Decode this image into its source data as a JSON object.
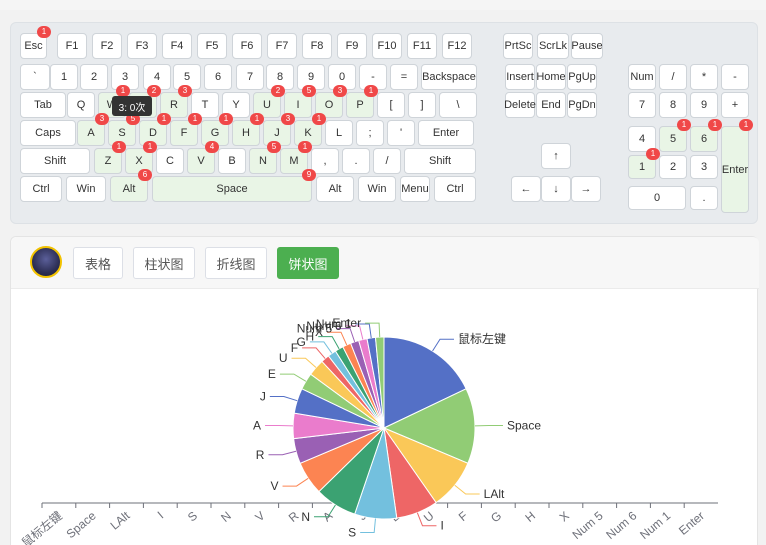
{
  "keyboard": {
    "rows": [
      [
        {
          "id": "esc",
          "label": "Esc",
          "count": "1"
        },
        {
          "id": "f1",
          "label": "F1"
        },
        {
          "id": "f2",
          "label": "F2"
        },
        {
          "id": "f3",
          "label": "F3"
        },
        {
          "id": "f4",
          "label": "F4"
        },
        {
          "id": "f5",
          "label": "F5"
        },
        {
          "id": "f6",
          "label": "F6"
        },
        {
          "id": "f7",
          "label": "F7"
        },
        {
          "id": "f8",
          "label": "F8"
        },
        {
          "id": "f9",
          "label": "F9"
        },
        {
          "id": "f10",
          "label": "F10"
        },
        {
          "id": "f11",
          "label": "F11"
        },
        {
          "id": "f12",
          "label": "F12"
        },
        {
          "id": "prtsc",
          "label": "PrtSc"
        },
        {
          "id": "scrlk",
          "label": "ScrLk"
        },
        {
          "id": "pause",
          "label": "Pause"
        }
      ],
      [
        {
          "id": "backtick",
          "label": "`"
        },
        {
          "id": "d1",
          "label": "1"
        },
        {
          "id": "d2",
          "label": "2"
        },
        {
          "id": "d3",
          "label": "3"
        },
        {
          "id": "d4",
          "label": "4"
        },
        {
          "id": "d5",
          "label": "5"
        },
        {
          "id": "d6",
          "label": "6"
        },
        {
          "id": "d7",
          "label": "7"
        },
        {
          "id": "d8",
          "label": "8"
        },
        {
          "id": "d9",
          "label": "9"
        },
        {
          "id": "d0",
          "label": "0"
        },
        {
          "id": "minus",
          "label": "-"
        },
        {
          "id": "equal",
          "label": "="
        },
        {
          "id": "backspace",
          "label": "Backspace"
        },
        {
          "id": "insert",
          "label": "Insert"
        },
        {
          "id": "home",
          "label": "Home"
        },
        {
          "id": "pgup",
          "label": "PgUp"
        },
        {
          "id": "numlock",
          "label": "Num"
        },
        {
          "id": "numdiv",
          "label": "/"
        },
        {
          "id": "nummul",
          "label": "*"
        },
        {
          "id": "numsub",
          "label": "-"
        }
      ],
      [
        {
          "id": "tab",
          "label": "Tab"
        },
        {
          "id": "q",
          "label": "Q"
        },
        {
          "id": "w",
          "label": "W",
          "count": "1",
          "pressed": true
        },
        {
          "id": "e",
          "label": "E",
          "count": "2",
          "pressed": true
        },
        {
          "id": "r",
          "label": "R",
          "count": "3",
          "pressed": true
        },
        {
          "id": "t",
          "label": "T"
        },
        {
          "id": "y",
          "label": "Y"
        },
        {
          "id": "u",
          "label": "U",
          "count": "2",
          "pressed": true
        },
        {
          "id": "i",
          "label": "I",
          "count": "5",
          "pressed": true
        },
        {
          "id": "o",
          "label": "O",
          "count": "3",
          "pressed": true
        },
        {
          "id": "p",
          "label": "P",
          "count": "1",
          "pressed": true
        },
        {
          "id": "lbracket",
          "label": "["
        },
        {
          "id": "rbracket",
          "label": "]"
        },
        {
          "id": "backslash",
          "label": "\\"
        },
        {
          "id": "delete",
          "label": "Delete"
        },
        {
          "id": "end",
          "label": "End"
        },
        {
          "id": "pgdn",
          "label": "PgDn"
        },
        {
          "id": "num7",
          "label": "7"
        },
        {
          "id": "num8",
          "label": "8"
        },
        {
          "id": "num9",
          "label": "9"
        },
        {
          "id": "numadd",
          "label": "+"
        }
      ],
      [
        {
          "id": "caps",
          "label": "Caps"
        },
        {
          "id": "a",
          "label": "A",
          "count": "3",
          "pressed": true
        },
        {
          "id": "s",
          "label": "S",
          "count": "5",
          "pressed": true
        },
        {
          "id": "d",
          "label": "D",
          "count": "1",
          "pressed": true
        },
        {
          "id": "f",
          "label": "F",
          "count": "1",
          "pressed": true
        },
        {
          "id": "g",
          "label": "G",
          "count": "1",
          "pressed": true
        },
        {
          "id": "h",
          "label": "H",
          "count": "1",
          "pressed": true
        },
        {
          "id": "j",
          "label": "J",
          "count": "3",
          "pressed": true
        },
        {
          "id": "k",
          "label": "K",
          "count": "1",
          "pressed": true
        },
        {
          "id": "l",
          "label": "L"
        },
        {
          "id": "semicolon",
          "label": ";"
        },
        {
          "id": "quote",
          "label": "'"
        },
        {
          "id": "enter",
          "label": "Enter"
        },
        {
          "id": "num4",
          "label": "4"
        },
        {
          "id": "num5",
          "label": "5",
          "count": "1",
          "pressed": true
        },
        {
          "id": "num6",
          "label": "6",
          "count": "1",
          "pressed": true
        },
        {
          "id": "numenter",
          "label": "Enter",
          "count": "1",
          "pressed": true
        }
      ],
      [
        {
          "id": "lshift",
          "label": "Shift"
        },
        {
          "id": "z",
          "label": "Z",
          "count": "1",
          "pressed": true
        },
        {
          "id": "x",
          "label": "X",
          "count": "1",
          "pressed": true
        },
        {
          "id": "c",
          "label": "C"
        },
        {
          "id": "v",
          "label": "V",
          "count": "4",
          "pressed": true
        },
        {
          "id": "b",
          "label": "B"
        },
        {
          "id": "n",
          "label": "N",
          "count": "5",
          "pressed": true
        },
        {
          "id": "m",
          "label": "M",
          "count": "1",
          "pressed": true
        },
        {
          "id": "comma",
          "label": ","
        },
        {
          "id": "period",
          "label": "."
        },
        {
          "id": "slash",
          "label": "/"
        },
        {
          "id": "rshift",
          "label": "Shift"
        },
        {
          "id": "up",
          "label": "↑"
        },
        {
          "id": "num1",
          "label": "1",
          "count": "1",
          "pressed": true
        },
        {
          "id": "num2",
          "label": "2"
        },
        {
          "id": "num3",
          "label": "3"
        }
      ],
      [
        {
          "id": "lctrl",
          "label": "Ctrl"
        },
        {
          "id": "lwin",
          "label": "Win"
        },
        {
          "id": "lalt",
          "label": "Alt",
          "count": "6",
          "pressed": true
        },
        {
          "id": "space",
          "label": "Space",
          "count": "9",
          "pressed": true
        },
        {
          "id": "ralt",
          "label": "Alt"
        },
        {
          "id": "rwin",
          "label": "Win"
        },
        {
          "id": "menu",
          "label": "Menu"
        },
        {
          "id": "rctrl",
          "label": "Ctrl"
        },
        {
          "id": "left",
          "label": "←"
        },
        {
          "id": "down",
          "label": "↓"
        },
        {
          "id": "right",
          "label": "→"
        },
        {
          "id": "num0",
          "label": "0"
        },
        {
          "id": "numdot",
          "label": "."
        }
      ]
    ],
    "tooltip": "3: 0次"
  },
  "tabs": [
    {
      "id": "table",
      "label": "表格"
    },
    {
      "id": "bar",
      "label": "柱状图"
    },
    {
      "id": "line",
      "label": "折线图"
    },
    {
      "id": "pie",
      "label": "饼状图",
      "active": true
    }
  ],
  "colors": {
    "accent": "#4caf50",
    "badge": "#f04848",
    "pressed": "#e9f5e6"
  },
  "chart_data": {
    "type": "pie",
    "slices": [
      {
        "name": "鼠标左键",
        "value": 12,
        "color": "#5470c6"
      },
      {
        "name": "Space",
        "value": 9,
        "color": "#91cc75"
      },
      {
        "name": "LAlt",
        "value": 6,
        "color": "#fac858"
      },
      {
        "name": "I",
        "value": 5,
        "color": "#ee6666"
      },
      {
        "name": "S",
        "value": 5,
        "color": "#73c0de"
      },
      {
        "name": "N",
        "value": 5,
        "color": "#3ba272"
      },
      {
        "name": "V",
        "value": 4,
        "color": "#fc8452"
      },
      {
        "name": "R",
        "value": 3,
        "color": "#9a60b4"
      },
      {
        "name": "A",
        "value": 3,
        "color": "#ea7ccc"
      },
      {
        "name": "J",
        "value": 3,
        "color": "#5470c6"
      },
      {
        "name": "E",
        "value": 2,
        "color": "#91cc75"
      },
      {
        "name": "U",
        "value": 2,
        "color": "#fac858"
      },
      {
        "name": "F",
        "value": 1,
        "color": "#ee6666"
      },
      {
        "name": "G",
        "value": 1,
        "color": "#73c0de"
      },
      {
        "name": "H",
        "value": 1,
        "color": "#3ba272"
      },
      {
        "name": "X",
        "value": 1,
        "color": "#fc8452"
      },
      {
        "name": "Num 5",
        "value": 1,
        "color": "#9a60b4"
      },
      {
        "name": "Num 6",
        "value": 1,
        "color": "#ea7ccc"
      },
      {
        "name": "Num 1",
        "value": 1,
        "color": "#5470c6"
      },
      {
        "name": "Enter",
        "value": 1,
        "color": "#91cc75"
      }
    ],
    "axis_categories": [
      "鼠标左键",
      "Space",
      "LAlt",
      "I",
      "S",
      "N",
      "V",
      "R",
      "A",
      "J",
      "E",
      "U",
      "F",
      "G",
      "H",
      "X",
      "Num 5",
      "Num 6",
      "Num 1",
      "Enter"
    ]
  }
}
